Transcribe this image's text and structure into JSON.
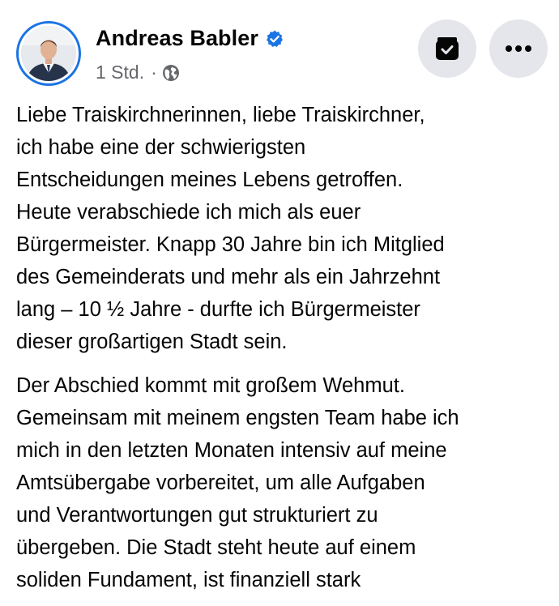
{
  "post": {
    "author_name": "Andreas Babler",
    "timestamp": "1 Std.",
    "separator": "·",
    "privacy_icon": "globe-icon",
    "verified_icon": "verified-badge-icon",
    "archive_icon": "archive-icon",
    "more_icon": "more-options-icon",
    "paragraphs": [
      [
        "Liebe Traiskirchnerinnen, liebe Traiskirchner,",
        "ich habe eine der schwierigsten",
        "Entscheidungen meines Lebens getroffen.",
        "Heute verabschiede ich mich als euer",
        "Bürgermeister. Knapp 30 Jahre bin ich Mitglied",
        "des Gemeinderats und mehr als ein Jahrzehnt",
        "lang – 10 ½ Jahre - durfte ich Bürgermeister",
        "dieser großartigen Stadt sein."
      ],
      [
        "Der Abschied kommt mit großem Wehmut.",
        "Gemeinsam mit meinem engsten Team habe ich",
        "mich in den letzten Monaten intensiv auf meine",
        "Amtsübergabe vorbereitet, um alle Aufgaben",
        "und Verantwortungen gut strukturiert zu",
        "übergeben. Die Stadt steht heute auf einem",
        "soliden Fundament, ist finanziell stark"
      ]
    ]
  },
  "colors": {
    "verified_blue": "#1b74e4",
    "meta_gray": "#65676b",
    "button_bg": "#e4e6eb",
    "text": "#050505"
  }
}
